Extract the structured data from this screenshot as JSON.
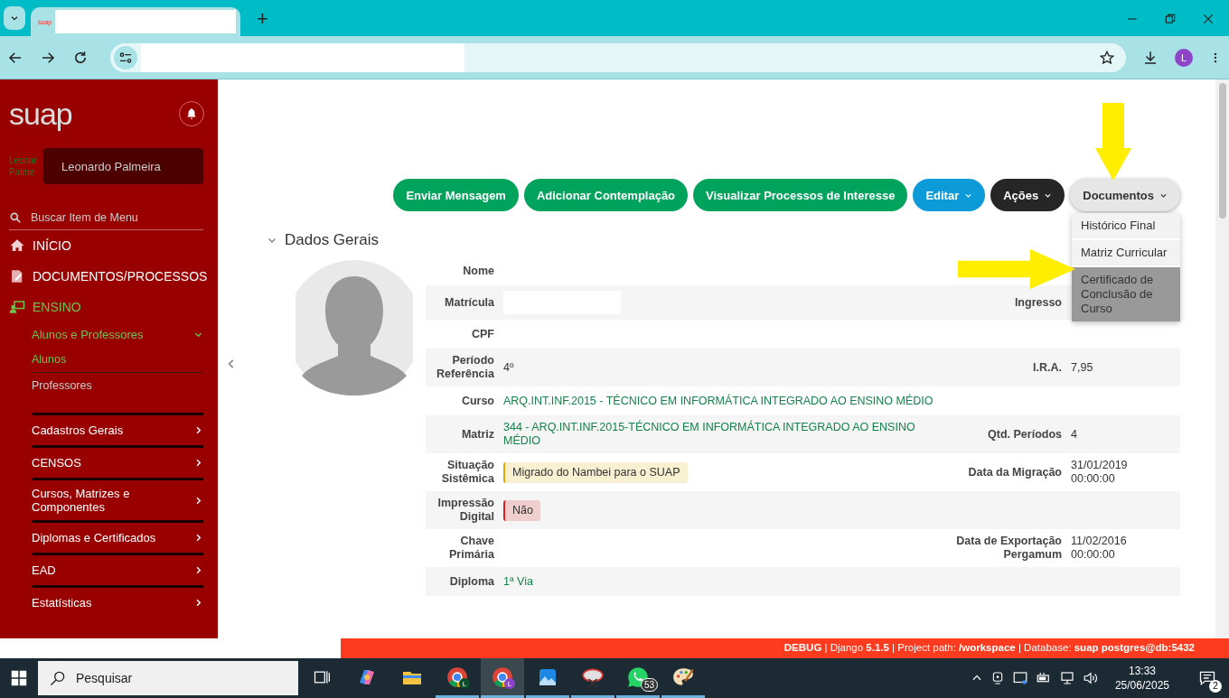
{
  "browser": {
    "tab": {
      "favicon": "suap",
      "selected": true
    },
    "new_tab": "+",
    "profile": "L"
  },
  "sidebar": {
    "logo": "suap",
    "user": {
      "avatar_alt": "Leonar Palme",
      "name": "Leonardo Palmeira"
    },
    "search": {
      "placeholder": "Buscar Item de Menu"
    },
    "menu": [
      {
        "label": "INÍCIO",
        "selected": false
      },
      {
        "label": "DOCUMENTOS/PROCESSOS",
        "selected": false
      },
      {
        "label": "ENSINO",
        "selected": true,
        "children": [
          {
            "label": "Alunos e Professores",
            "selected": true,
            "expanded": true,
            "children": [
              {
                "label": "Alunos",
                "selected": true
              },
              {
                "label": "Professores",
                "selected": false
              }
            ]
          },
          {
            "label": "Cadastros Gerais",
            "selected": false,
            "expanded": false
          },
          {
            "label": "CENSOS",
            "selected": false,
            "expanded": false
          },
          {
            "label": "Cursos, Matrizes e Componentes",
            "selected": false,
            "expanded": false
          },
          {
            "label": "Diplomas e Certificados",
            "selected": false,
            "expanded": false
          },
          {
            "label": "EAD",
            "selected": false,
            "expanded": false
          },
          {
            "label": "Estatísticas",
            "selected": false,
            "expanded": false
          }
        ]
      }
    ]
  },
  "actions": [
    {
      "label": "Enviar Mensagem",
      "kind": "success",
      "dropdown": false
    },
    {
      "label": "Adicionar Contemplação",
      "kind": "success",
      "dropdown": false
    },
    {
      "label": "Visualizar Processos de Interesse",
      "kind": "success",
      "dropdown": false
    },
    {
      "label": "Editar",
      "kind": "info",
      "dropdown": true,
      "expanded": false
    },
    {
      "label": "Ações",
      "kind": "dark",
      "dropdown": true,
      "expanded": false
    },
    {
      "label": "Documentos",
      "kind": "default",
      "dropdown": true,
      "expanded": true,
      "items": [
        {
          "label": "Histórico Final",
          "selected": false
        },
        {
          "label": "Matriz Curricular",
          "selected": false
        },
        {
          "label": "Certificado de Conclusão de Curso",
          "selected": true
        }
      ]
    }
  ],
  "section": {
    "title": "Dados Gerais",
    "expanded": true
  },
  "fields": [
    {
      "label": "Nome",
      "redacted": false
    },
    {
      "label": "Matrícula",
      "redacted": true,
      "right_label": "Ingresso"
    },
    {
      "label": "CPF",
      "redacted": false
    },
    {
      "label": "Período Referência",
      "value": "4º",
      "kind": "text",
      "right_label": "I.R.A.",
      "right_value": "7,95"
    },
    {
      "label": "Curso",
      "value": "ARQ.INT.INF.2015 - TÉCNICO EM INFORMÁTICA INTEGRADO AO ENSINO MÉDIO",
      "kind": "link"
    },
    {
      "label": "Matriz",
      "value": "344 - ARQ.INT.INF.2015-TÉCNICO EM INFORMÁTICA INTEGRADO AO ENSINO MÉDIO",
      "kind": "link",
      "right_label": "Qtd. Períodos",
      "right_value": "4"
    },
    {
      "label": "Situação Sistêmica",
      "value": "Migrado do Nambei para o SUAP",
      "kind": "badge",
      "color": "#e0a800",
      "right_label": "Data da Migração",
      "right_value": "31/01/2019 00:00:00"
    },
    {
      "label": "Impressão Digital",
      "value": "Não",
      "kind": "badge",
      "color": "#e02020"
    },
    {
      "label": "Chave Primária",
      "right_label": "Data de Exportação Pergamum",
      "right_value": "11/02/2016 00:00:00"
    },
    {
      "label": "Diploma",
      "value": "1ª Via",
      "kind": "link"
    }
  ],
  "debug_bar": "**DEBUG** | Django **5.1.5** | Project path: **/workspace** | Database: **suap postgres@db:5432**",
  "taskbar": {
    "search": {
      "placeholder": "Pesquisar"
    },
    "apps": [
      {
        "kind": "taskview",
        "running": false,
        "selected": false
      },
      {
        "kind": "copilot",
        "running": false,
        "selected": false
      },
      {
        "kind": "files",
        "running": false,
        "selected": false
      },
      {
        "kind": "chrome",
        "avatar": "L",
        "running": true,
        "selected": false
      },
      {
        "kind": "chrome",
        "avatar": "L",
        "running": true,
        "selected": true
      },
      {
        "kind": "photos",
        "running": true,
        "selected": false
      },
      {
        "kind": "snip",
        "running": true,
        "selected": false
      },
      {
        "kind": "whatsapp",
        "badge": "53",
        "running": true,
        "selected": false
      },
      {
        "kind": "paint",
        "running": true,
        "selected": false
      }
    ],
    "time": "13:33",
    "date": "25/06/2025",
    "notifications": "2"
  }
}
